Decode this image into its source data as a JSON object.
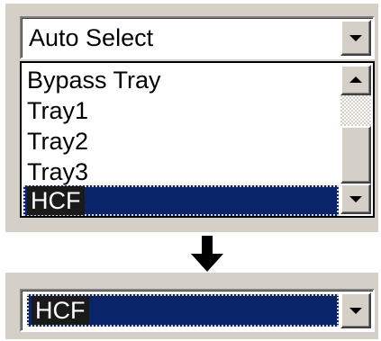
{
  "top_combo": {
    "value": "Auto Select"
  },
  "dropdown_list": {
    "items": [
      {
        "label": "Bypass Tray",
        "selected": false
      },
      {
        "label": "Tray1",
        "selected": false
      },
      {
        "label": "Tray2",
        "selected": false
      },
      {
        "label": "Tray3",
        "selected": false
      },
      {
        "label": "HCF",
        "selected": true
      }
    ]
  },
  "bottom_combo": {
    "value": "HCF"
  },
  "icons": {
    "dropdown_button": "chevron-down-icon",
    "scroll_up": "scroll-up-arrow-icon",
    "scroll_down": "scroll-down-arrow-icon",
    "transition": "arrow-down-icon"
  },
  "colors": {
    "face": "#d4d0c8",
    "highlight": "#0a246a",
    "text": "#000000",
    "highlight_text": "#ffffff"
  }
}
